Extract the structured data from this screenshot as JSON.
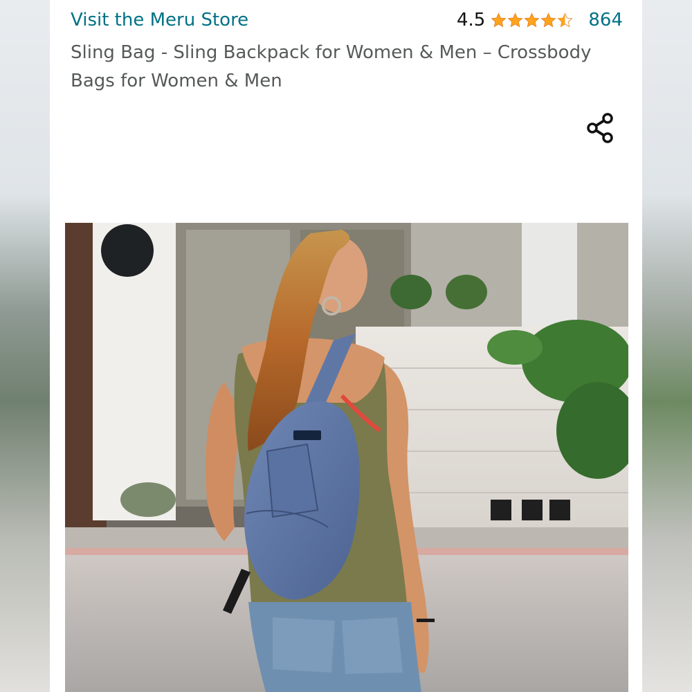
{
  "store": {
    "link_text": "Visit the Meru Store"
  },
  "rating": {
    "value": "4.5",
    "stars": 4.5,
    "review_count": "864",
    "star_color": "#ffa41c"
  },
  "product": {
    "title": "Sling Bag - Sling Backpack for Women & Men – Crossbody Bags for Women & Men"
  },
  "share": {
    "icon": "share-icon"
  },
  "image": {
    "subject": "woman-wearing-blue-sling-backpack"
  },
  "colors": {
    "link": "#007185",
    "title": "#565959",
    "text": "#0f1111"
  }
}
